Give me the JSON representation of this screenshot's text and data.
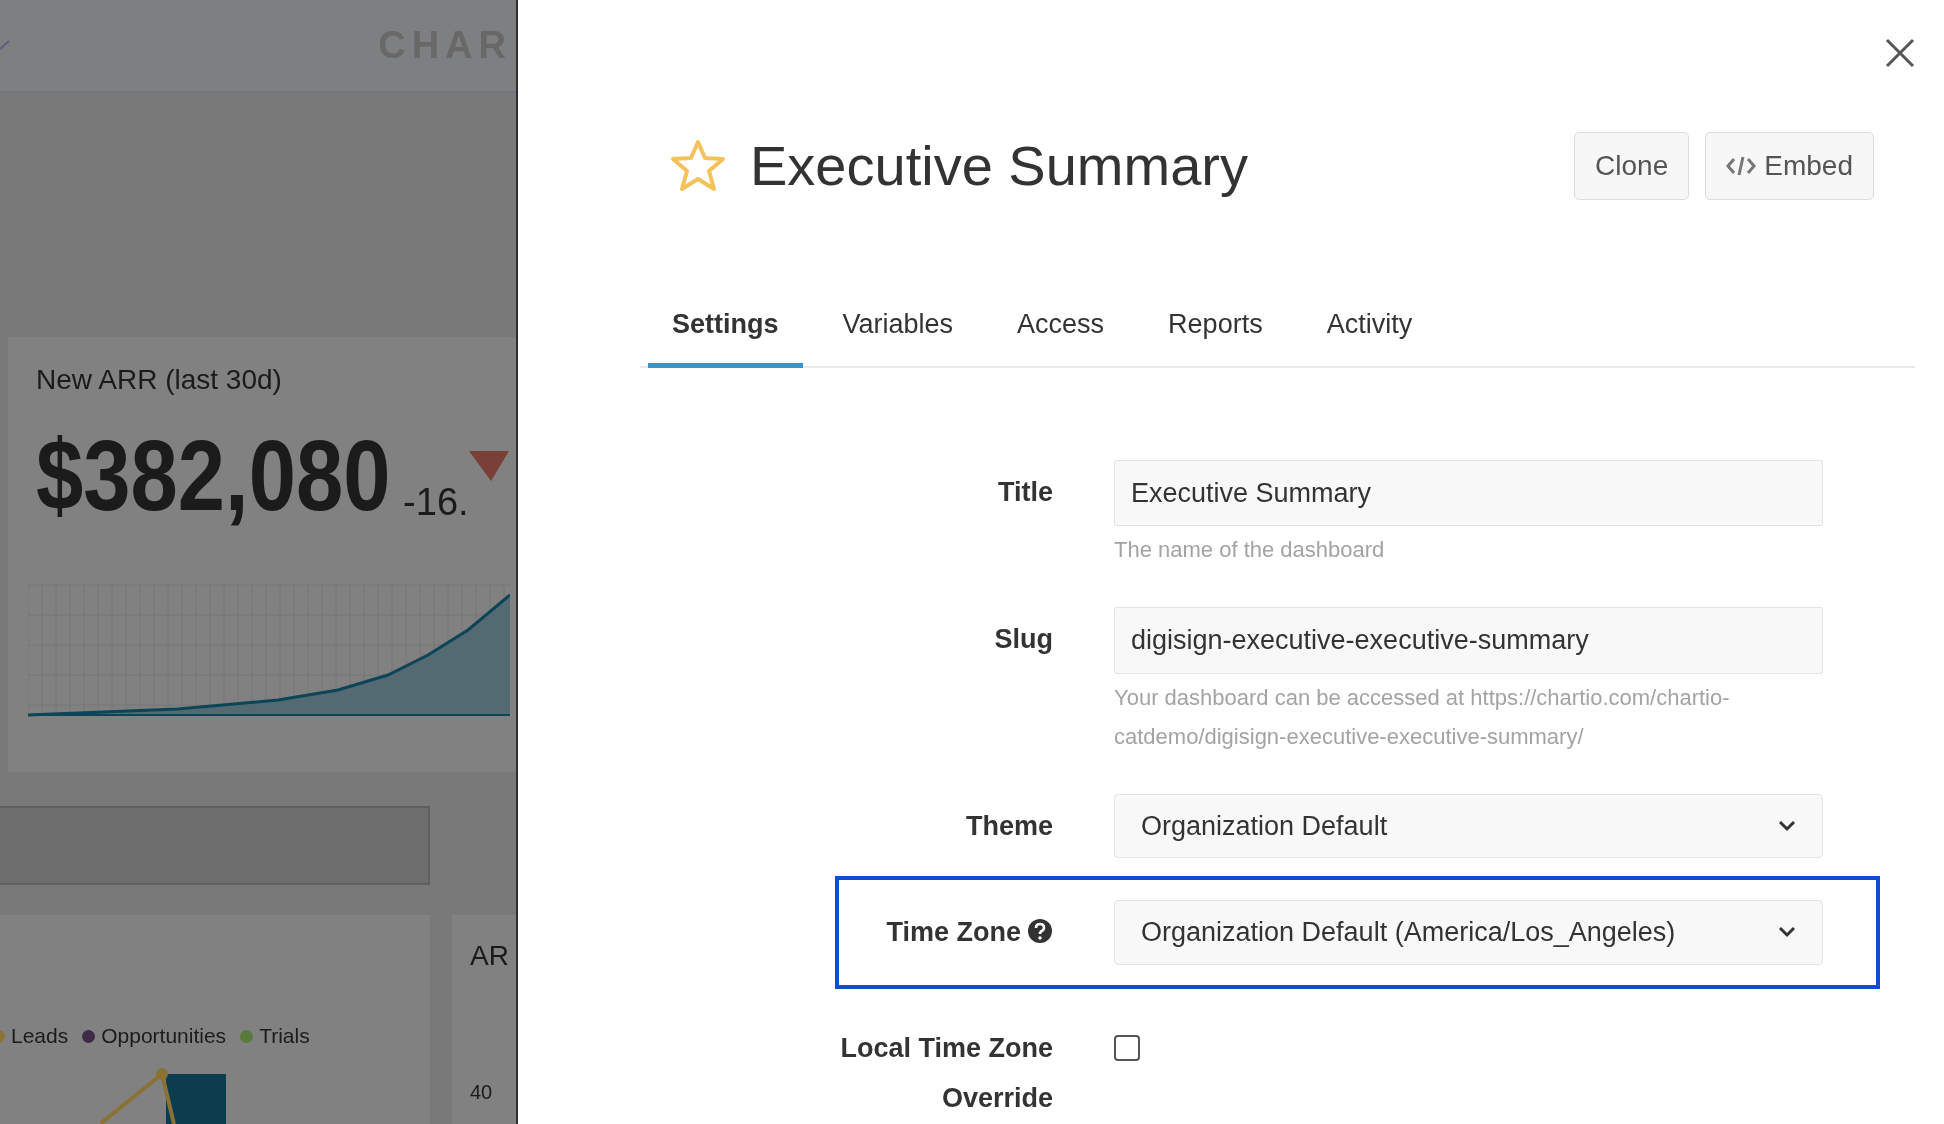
{
  "backdrop": {
    "brand_text": "CHAR",
    "kpi": {
      "title": "New ARR (last 30d)",
      "value": "$382,080",
      "change": "-16."
    },
    "legend": [
      {
        "label": "Leads",
        "color": "#8a7135"
      },
      {
        "label": "Opportunities",
        "color": "#3e2b47"
      },
      {
        "label": "Trials",
        "color": "#587a3c"
      }
    ],
    "side_card": {
      "title": "AR",
      "axis_label": "40"
    }
  },
  "panel": {
    "starred": false,
    "title": "Executive Summary",
    "buttons": [
      {
        "label": "Clone",
        "kind": "text"
      },
      {
        "label": "Embed",
        "kind": "code"
      }
    ],
    "tabs": [
      {
        "label": "Settings",
        "selected": true
      },
      {
        "label": "Variables",
        "selected": false
      },
      {
        "label": "Access",
        "selected": false
      },
      {
        "label": "Reports",
        "selected": false
      },
      {
        "label": "Activity",
        "selected": false
      }
    ],
    "fields": [
      {
        "kind": "text",
        "label": "Title",
        "value": "Executive Summary",
        "help": "The name of the dashboard",
        "highlighted": false
      },
      {
        "kind": "text",
        "label": "Slug",
        "value": "digisign-executive-executive-summary",
        "help": "Your dashboard can be accessed at https://chartio.com/chartio-catdemo/digisign-executive-executive-summary/",
        "highlighted": false
      },
      {
        "kind": "select",
        "label": "Theme",
        "value": "Organization Default",
        "highlighted": false
      },
      {
        "kind": "select",
        "label": "Time Zone",
        "value": "Organization Default (America/Los_Angeles)",
        "help_icon": true,
        "highlighted": true
      },
      {
        "kind": "checkbox",
        "label": "Local Time Zone Override",
        "checked": false,
        "highlighted": false
      }
    ]
  }
}
